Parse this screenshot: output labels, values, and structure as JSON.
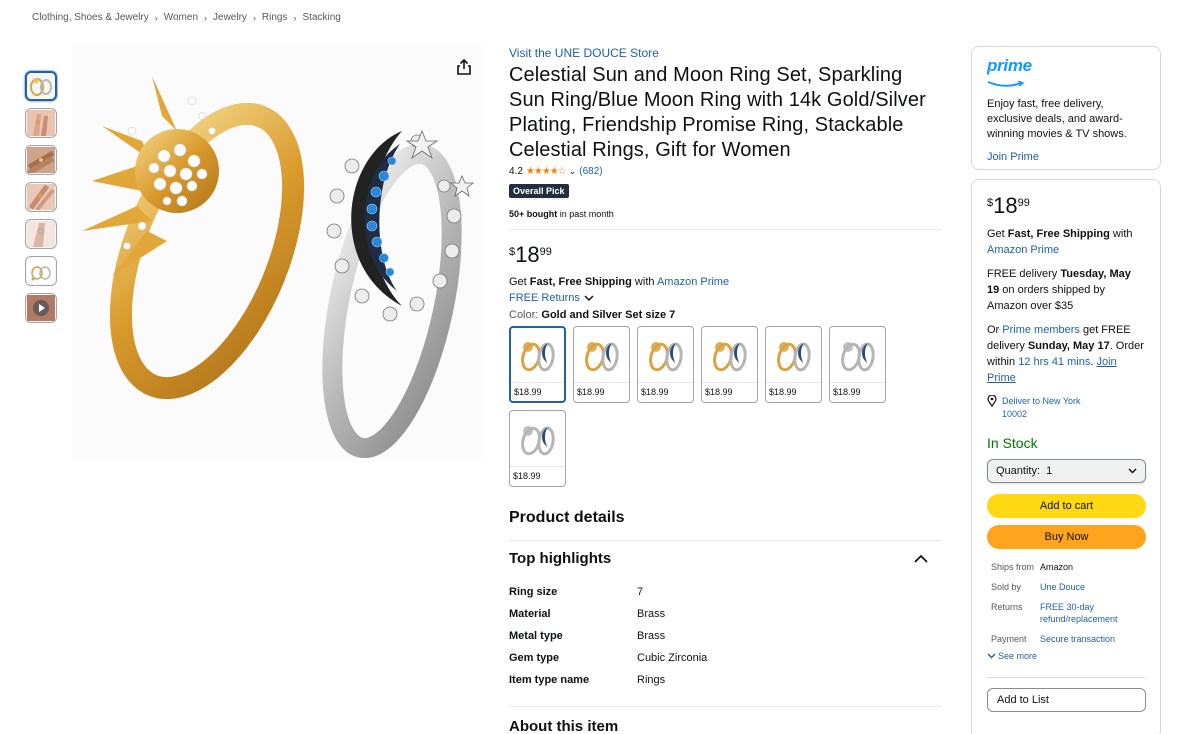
{
  "breadcrumb": [
    "Clothing, Shoes & Jewelry",
    "Women",
    "Jewelry",
    "Rings",
    "Stacking"
  ],
  "product": {
    "store_link": "Visit the UNE DOUCE Store",
    "title": "Celestial Sun and Moon Ring Set, Sparkling Sun Ring/Blue Moon Ring with 14k Gold/Silver Plating, Friendship Promise Ring, Stackable Celestial Rings, Gift for Women",
    "rating": "4.2",
    "stars": "★★★★☆",
    "review_count": "(682)",
    "badge": "Overall Pick",
    "bought_bold": "50+ bought",
    "bought_rest": " in past month",
    "price_symbol": "$",
    "price_whole": "18",
    "price_fraction": "99",
    "shipping_pre": "Get ",
    "shipping_bold": "Fast, Free Shipping",
    "shipping_mid": " with ",
    "shipping_link": "Amazon Prime",
    "free_returns": "FREE Returns",
    "color_label": "Color: ",
    "color_value": "Gold and Silver Set size 7",
    "swatch_prices": [
      "$18.99",
      "$18.99",
      "$18.99",
      "$18.99",
      "$18.99",
      "$18.99",
      "$18.99"
    ]
  },
  "product_details": {
    "heading": "Product details",
    "top_highlights": "Top highlights",
    "rows": [
      {
        "key": "Ring size",
        "value": "7"
      },
      {
        "key": "Material",
        "value": "Brass"
      },
      {
        "key": "Metal type",
        "value": "Brass"
      },
      {
        "key": "Gem type",
        "value": "Cubic Zirconia"
      },
      {
        "key": "Item type name",
        "value": "Rings"
      }
    ],
    "about": "About this item"
  },
  "prime_card": {
    "logo": "prime",
    "text": "Enjoy fast, free delivery, exclusive deals, and award-winning movies & TV shows.",
    "join": "Join Prime"
  },
  "buy_box": {
    "price_symbol": "$",
    "price_whole": "18",
    "price_fraction": "99",
    "ship_pre": "Get ",
    "ship_bold": "Fast, Free Shipping",
    "ship_mid": " with ",
    "ship_link": "Amazon Prime",
    "delivery_pre": "FREE delivery ",
    "delivery_date": "Tuesday, May 19",
    "delivery_post": " on orders shipped by Amazon over $35",
    "or": "Or ",
    "prime_members": "Prime members",
    "get_free": " get FREE delivery ",
    "fast_date": "Sunday, May 17",
    "order_within": ". Order within ",
    "countdown": "12 hrs 41 mins",
    "join_prime": "Join Prime",
    "deliver_to": "Deliver to New York 10002",
    "in_stock": "In Stock",
    "quantity_label": "Quantity:",
    "quantity_value": "1",
    "add_to_cart": "Add to cart",
    "buy_now": "Buy Now",
    "ships_from_label": "Ships from",
    "ships_from": "Amazon",
    "sold_by_label": "Sold by",
    "sold_by": "Une Douce",
    "returns_label": "Returns",
    "returns": "FREE 30-day refund/replacement",
    "payment_label": "Payment",
    "payment": "Secure transaction",
    "see_more": "See more",
    "add_to_list": "Add to List"
  },
  "colors": {
    "link": "#2162a1",
    "in_stock": "#007600",
    "cart": "#ffd814",
    "buy": "#ffa41c",
    "prime": "#1399ff",
    "star": "#f08804"
  }
}
